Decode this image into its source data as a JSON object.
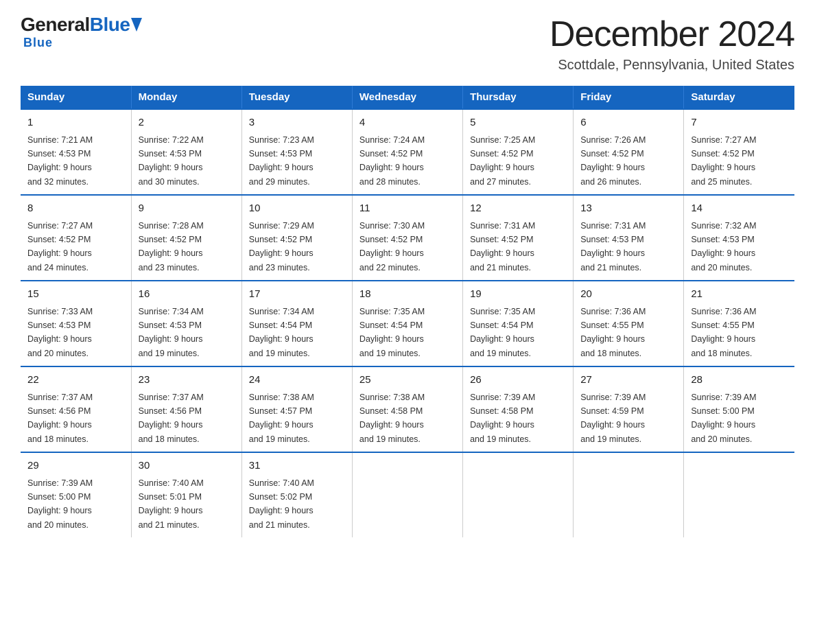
{
  "logo": {
    "general": "General",
    "blue": "Blue",
    "tagline": "Blue"
  },
  "title": "December 2024",
  "subtitle": "Scottdale, Pennsylvania, United States",
  "days_of_week": [
    "Sunday",
    "Monday",
    "Tuesday",
    "Wednesday",
    "Thursday",
    "Friday",
    "Saturday"
  ],
  "weeks": [
    [
      {
        "day": "1",
        "sunrise": "7:21 AM",
        "sunset": "4:53 PM",
        "daylight": "9 hours and 32 minutes."
      },
      {
        "day": "2",
        "sunrise": "7:22 AM",
        "sunset": "4:53 PM",
        "daylight": "9 hours and 30 minutes."
      },
      {
        "day": "3",
        "sunrise": "7:23 AM",
        "sunset": "4:53 PM",
        "daylight": "9 hours and 29 minutes."
      },
      {
        "day": "4",
        "sunrise": "7:24 AM",
        "sunset": "4:52 PM",
        "daylight": "9 hours and 28 minutes."
      },
      {
        "day": "5",
        "sunrise": "7:25 AM",
        "sunset": "4:52 PM",
        "daylight": "9 hours and 27 minutes."
      },
      {
        "day": "6",
        "sunrise": "7:26 AM",
        "sunset": "4:52 PM",
        "daylight": "9 hours and 26 minutes."
      },
      {
        "day": "7",
        "sunrise": "7:27 AM",
        "sunset": "4:52 PM",
        "daylight": "9 hours and 25 minutes."
      }
    ],
    [
      {
        "day": "8",
        "sunrise": "7:27 AM",
        "sunset": "4:52 PM",
        "daylight": "9 hours and 24 minutes."
      },
      {
        "day": "9",
        "sunrise": "7:28 AM",
        "sunset": "4:52 PM",
        "daylight": "9 hours and 23 minutes."
      },
      {
        "day": "10",
        "sunrise": "7:29 AM",
        "sunset": "4:52 PM",
        "daylight": "9 hours and 23 minutes."
      },
      {
        "day": "11",
        "sunrise": "7:30 AM",
        "sunset": "4:52 PM",
        "daylight": "9 hours and 22 minutes."
      },
      {
        "day": "12",
        "sunrise": "7:31 AM",
        "sunset": "4:52 PM",
        "daylight": "9 hours and 21 minutes."
      },
      {
        "day": "13",
        "sunrise": "7:31 AM",
        "sunset": "4:53 PM",
        "daylight": "9 hours and 21 minutes."
      },
      {
        "day": "14",
        "sunrise": "7:32 AM",
        "sunset": "4:53 PM",
        "daylight": "9 hours and 20 minutes."
      }
    ],
    [
      {
        "day": "15",
        "sunrise": "7:33 AM",
        "sunset": "4:53 PM",
        "daylight": "9 hours and 20 minutes."
      },
      {
        "day": "16",
        "sunrise": "7:34 AM",
        "sunset": "4:53 PM",
        "daylight": "9 hours and 19 minutes."
      },
      {
        "day": "17",
        "sunrise": "7:34 AM",
        "sunset": "4:54 PM",
        "daylight": "9 hours and 19 minutes."
      },
      {
        "day": "18",
        "sunrise": "7:35 AM",
        "sunset": "4:54 PM",
        "daylight": "9 hours and 19 minutes."
      },
      {
        "day": "19",
        "sunrise": "7:35 AM",
        "sunset": "4:54 PM",
        "daylight": "9 hours and 19 minutes."
      },
      {
        "day": "20",
        "sunrise": "7:36 AM",
        "sunset": "4:55 PM",
        "daylight": "9 hours and 18 minutes."
      },
      {
        "day": "21",
        "sunrise": "7:36 AM",
        "sunset": "4:55 PM",
        "daylight": "9 hours and 18 minutes."
      }
    ],
    [
      {
        "day": "22",
        "sunrise": "7:37 AM",
        "sunset": "4:56 PM",
        "daylight": "9 hours and 18 minutes."
      },
      {
        "day": "23",
        "sunrise": "7:37 AM",
        "sunset": "4:56 PM",
        "daylight": "9 hours and 18 minutes."
      },
      {
        "day": "24",
        "sunrise": "7:38 AM",
        "sunset": "4:57 PM",
        "daylight": "9 hours and 19 minutes."
      },
      {
        "day": "25",
        "sunrise": "7:38 AM",
        "sunset": "4:58 PM",
        "daylight": "9 hours and 19 minutes."
      },
      {
        "day": "26",
        "sunrise": "7:39 AM",
        "sunset": "4:58 PM",
        "daylight": "9 hours and 19 minutes."
      },
      {
        "day": "27",
        "sunrise": "7:39 AM",
        "sunset": "4:59 PM",
        "daylight": "9 hours and 19 minutes."
      },
      {
        "day": "28",
        "sunrise": "7:39 AM",
        "sunset": "5:00 PM",
        "daylight": "9 hours and 20 minutes."
      }
    ],
    [
      {
        "day": "29",
        "sunrise": "7:39 AM",
        "sunset": "5:00 PM",
        "daylight": "9 hours and 20 minutes."
      },
      {
        "day": "30",
        "sunrise": "7:40 AM",
        "sunset": "5:01 PM",
        "daylight": "9 hours and 21 minutes."
      },
      {
        "day": "31",
        "sunrise": "7:40 AM",
        "sunset": "5:02 PM",
        "daylight": "9 hours and 21 minutes."
      },
      null,
      null,
      null,
      null
    ]
  ],
  "labels": {
    "sunrise": "Sunrise:",
    "sunset": "Sunset:",
    "daylight": "Daylight:"
  }
}
